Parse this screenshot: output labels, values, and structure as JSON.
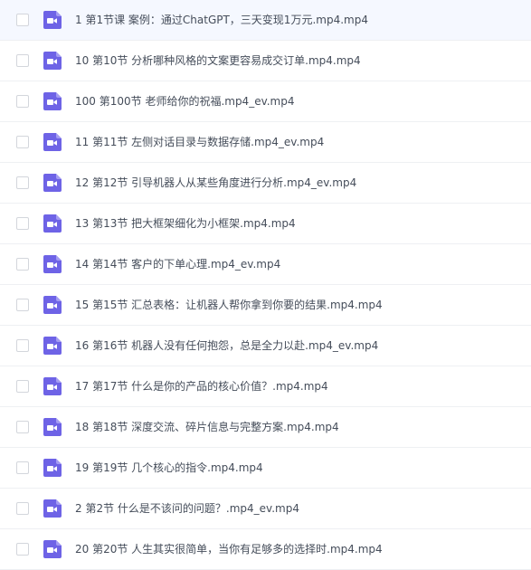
{
  "file_list": {
    "icon_name": "video-file-icon",
    "icon_color": "#6e63e6",
    "items": [
      {
        "name": "1 第1节课 案例：通过ChatGPT，三天变现1万元.mp4.mp4"
      },
      {
        "name": "10 第10节 分析哪种风格的文案更容易成交订单.mp4.mp4"
      },
      {
        "name": "100 第100节 老师给你的祝福.mp4_ev.mp4"
      },
      {
        "name": "11 第11节 左侧对话目录与数据存储.mp4_ev.mp4"
      },
      {
        "name": "12 第12节 引导机器人从某些角度进行分析.mp4_ev.mp4"
      },
      {
        "name": "13 第13节 把大框架细化为小框架.mp4.mp4"
      },
      {
        "name": "14 第14节 客户的下单心理.mp4_ev.mp4"
      },
      {
        "name": "15 第15节 汇总表格：让机器人帮你拿到你要的结果.mp4.mp4"
      },
      {
        "name": "16 第16节 机器人没有任何抱怨，总是全力以赴.mp4_ev.mp4"
      },
      {
        "name": "17 第17节 什么是你的产品的核心价值？.mp4.mp4"
      },
      {
        "name": "18 第18节 深度交流、碎片信息与完整方案.mp4.mp4"
      },
      {
        "name": "19 第19节 几个核心的指令.mp4.mp4"
      },
      {
        "name": "2 第2节 什么是不该问的问题？.mp4_ev.mp4"
      },
      {
        "name": "20 第20节 人生其实很简单，当你有足够多的选择时.mp4.mp4"
      }
    ]
  }
}
